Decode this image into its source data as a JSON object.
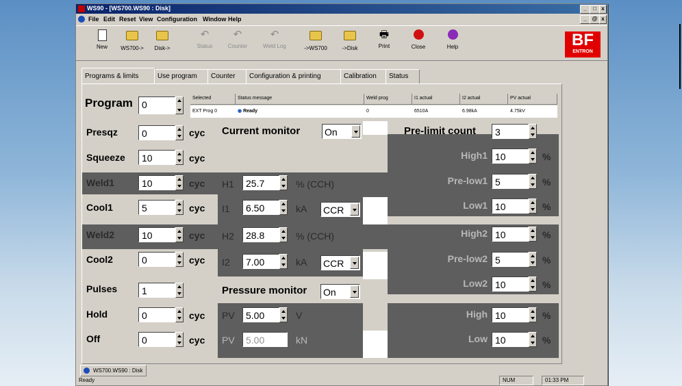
{
  "window": {
    "title": "WS90 - [WS700.WS90 : Disk]",
    "min": "_",
    "restore": "□",
    "close": "x",
    "child_min": "_",
    "child_restore": "@",
    "child_close": "x"
  },
  "menu": [
    "File",
    "Edit",
    "Reset",
    "View",
    "Configuration",
    "Window",
    "Help"
  ],
  "toolbar": {
    "new": "New",
    "ws700_from": "WS700->",
    "disk_from": "Disk->",
    "status": "Status",
    "counter": "Counter",
    "weld_log": "Weld Log",
    "to_ws700": "->WS700",
    "to_disk": "->Disk",
    "print": "Print",
    "close": "Close",
    "help": "Help"
  },
  "logo": {
    "big": "BF",
    "small": "ENTRON"
  },
  "tabs": [
    "Programs & limits",
    "Use program",
    "Counter",
    "Configuration & printing",
    "Calibration",
    "Status"
  ],
  "program": {
    "label": "Program",
    "value": "0"
  },
  "status_table": {
    "headers": [
      "Selected",
      "Status message",
      "Weld prog",
      "I1 actual",
      "I2 actual",
      "PV actual"
    ],
    "values": [
      "EXT Prog 0",
      "Ready",
      "0",
      "6510A",
      "6.98kA",
      "4.75kV"
    ]
  },
  "left": {
    "presqz": {
      "label": "Presqz",
      "value": "0",
      "unit": "cyc"
    },
    "squeeze": {
      "label": "Squeeze",
      "value": "10",
      "unit": "cyc"
    },
    "weld1": {
      "label": "Weld1",
      "value": "10",
      "unit": "cyc"
    },
    "cool1": {
      "label": "Cool1",
      "value": "5",
      "unit": "cyc"
    },
    "weld2": {
      "label": "Weld2",
      "value": "10",
      "unit": "cyc"
    },
    "cool2": {
      "label": "Cool2",
      "value": "0",
      "unit": "cyc"
    },
    "pulses": {
      "label": "Pulses",
      "value": "1"
    },
    "hold": {
      "label": "Hold",
      "value": "0",
      "unit": "cyc"
    },
    "off": {
      "label": "Off",
      "value": "0",
      "unit": "cyc"
    }
  },
  "mid": {
    "current_monitor": {
      "label": "Current monitor",
      "value": "On"
    },
    "h1": {
      "label": "H1",
      "value": "25.7",
      "unit": "% (CCH)"
    },
    "i1": {
      "label": "I1",
      "value": "6.50",
      "unit": "kA",
      "mode": "CCR"
    },
    "h2": {
      "label": "H2",
      "value": "28.8",
      "unit": "% (CCH)"
    },
    "i2": {
      "label": "I2",
      "value": "7.00",
      "unit": "kA",
      "mode": "CCR"
    },
    "pressure_monitor": {
      "label": "Pressure monitor",
      "value": "On"
    },
    "pv1": {
      "label": "PV",
      "value": "5.00",
      "unit": "V"
    },
    "pv2": {
      "label": "PV",
      "value": "5.00",
      "unit": "kN"
    }
  },
  "right": {
    "pre_limit": {
      "label": "Pre-limit count",
      "value": "3"
    },
    "high1": {
      "label": "High1",
      "value": "10",
      "unit": "%"
    },
    "prelow1": {
      "label": "Pre-low1",
      "value": "5",
      "unit": "%"
    },
    "low1": {
      "label": "Low1",
      "value": "10",
      "unit": "%"
    },
    "high2": {
      "label": "High2",
      "value": "10",
      "unit": "%"
    },
    "prelow2": {
      "label": "Pre-low2",
      "value": "5",
      "unit": "%"
    },
    "low2": {
      "label": "Low2",
      "value": "10",
      "unit": "%"
    },
    "high": {
      "label": "High",
      "value": "10",
      "unit": "%"
    },
    "low": {
      "label": "Low",
      "value": "10",
      "unit": "%"
    }
  },
  "doc_tab": "WS700.WS90 : Disk",
  "status_bar": {
    "text": "Ready",
    "num": "NUM",
    "time": "01:33 PM"
  },
  "colors": {
    "dark_band": "#5e5e5e",
    "face": "#d4d0c8",
    "logo": "#e10000"
  }
}
